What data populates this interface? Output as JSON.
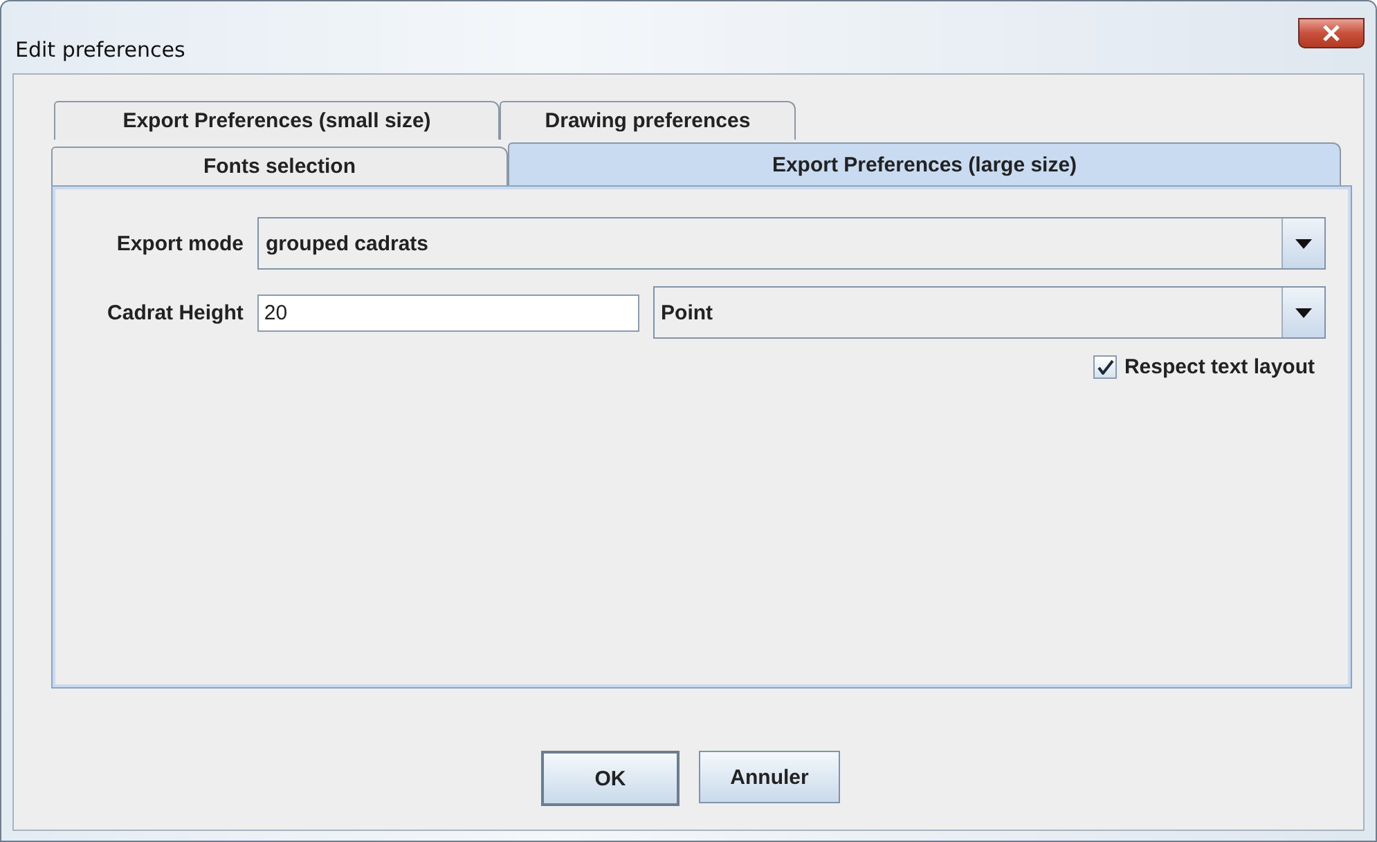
{
  "window": {
    "title": "Edit preferences"
  },
  "tab_rows": [
    {
      "tabs": [
        {
          "label": "Export Preferences (small size)",
          "selected": false
        },
        {
          "label": "Drawing preferences",
          "selected": false
        }
      ]
    },
    {
      "tabs": [
        {
          "label": "Fonts selection",
          "selected": false
        },
        {
          "label": "Export Preferences (large size)",
          "selected": true
        }
      ]
    }
  ],
  "export_mode": {
    "label": "Export mode",
    "value": "grouped cadrats"
  },
  "cadrat_height": {
    "label": "Cadrat Height",
    "value": "20",
    "unit": "Point"
  },
  "respect_layout": {
    "label": "Respect text layout",
    "checked": true
  },
  "buttons": [
    "OK",
    "Annuler"
  ]
}
